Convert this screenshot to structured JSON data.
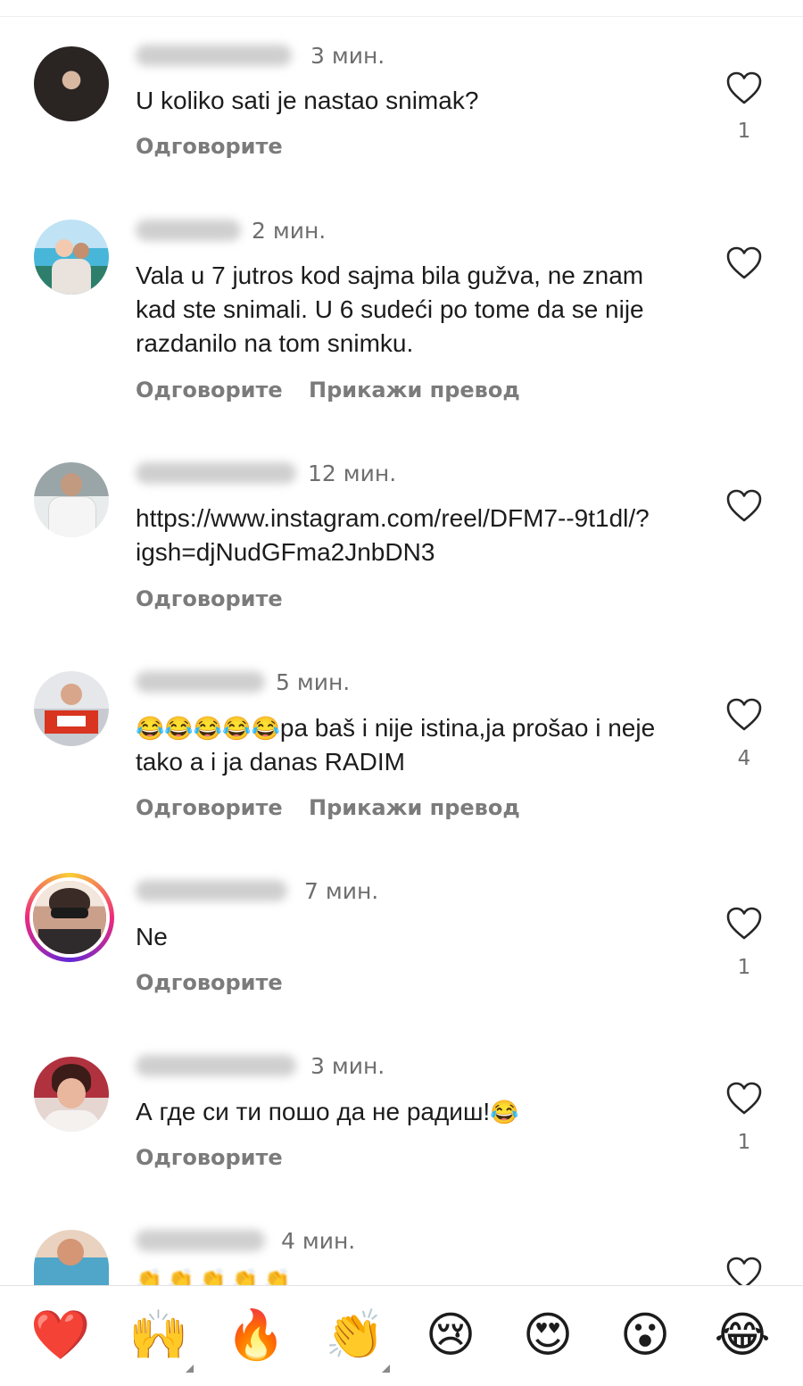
{
  "comments": [
    {
      "time": "3 мин.",
      "text": "U koliko sati je nastao snimak?",
      "reply": "Одговорите",
      "translate": "",
      "likes": "1"
    },
    {
      "time": "2 мин.",
      "text": "Vala u 7 jutros kod sajma bila gužva, ne znam kad ste snimali. U 6 sudeći po tome da se nije razdanilo na tom snimku.",
      "reply": "Одговорите",
      "translate": "Прикажи превод",
      "likes": ""
    },
    {
      "time": "12 мин.",
      "text": "https://www.instagram.com/reel/DFM7--9t1dl/?igsh=djNudGFma2JnbDN3",
      "reply": "Одговорите",
      "translate": "",
      "likes": ""
    },
    {
      "time": "5 мин.",
      "text_emoji": "😂😂😂😂😂",
      "text": "pa baš i nije istina,ja prošao i neje tako a i ja danas RADIM",
      "reply": "Одговорите",
      "translate": "Прикажи превод",
      "likes": "4"
    },
    {
      "time": "7 мин.",
      "text": "Ne",
      "reply": "Одговорите",
      "translate": "",
      "likes": "1"
    },
    {
      "time": "3 мин.",
      "text": "А где си ти пошо да не радиш!",
      "text_emoji": "😂",
      "reply": "Одговорите",
      "translate": "",
      "likes": "1"
    },
    {
      "time": "4 мин.",
      "text": "",
      "reply": "",
      "translate": "",
      "likes": ""
    }
  ],
  "reaction_bar": {
    "emojis": [
      "❤️",
      "🙌",
      "🔥",
      "👏",
      "😢",
      "😍",
      "😮",
      "😂"
    ],
    "icon_names": [
      "red-heart-icon",
      "raising-hands-icon",
      "fire-icon",
      "clapping-hands-icon",
      "crying-face-icon",
      "heart-eyes-icon",
      "surprised-face-icon",
      "tears-of-joy-icon"
    ]
  },
  "colors": {
    "heart_outline": "#262626",
    "secondary_text": "#7b7b7b",
    "like_red": "#ff3b5c"
  }
}
